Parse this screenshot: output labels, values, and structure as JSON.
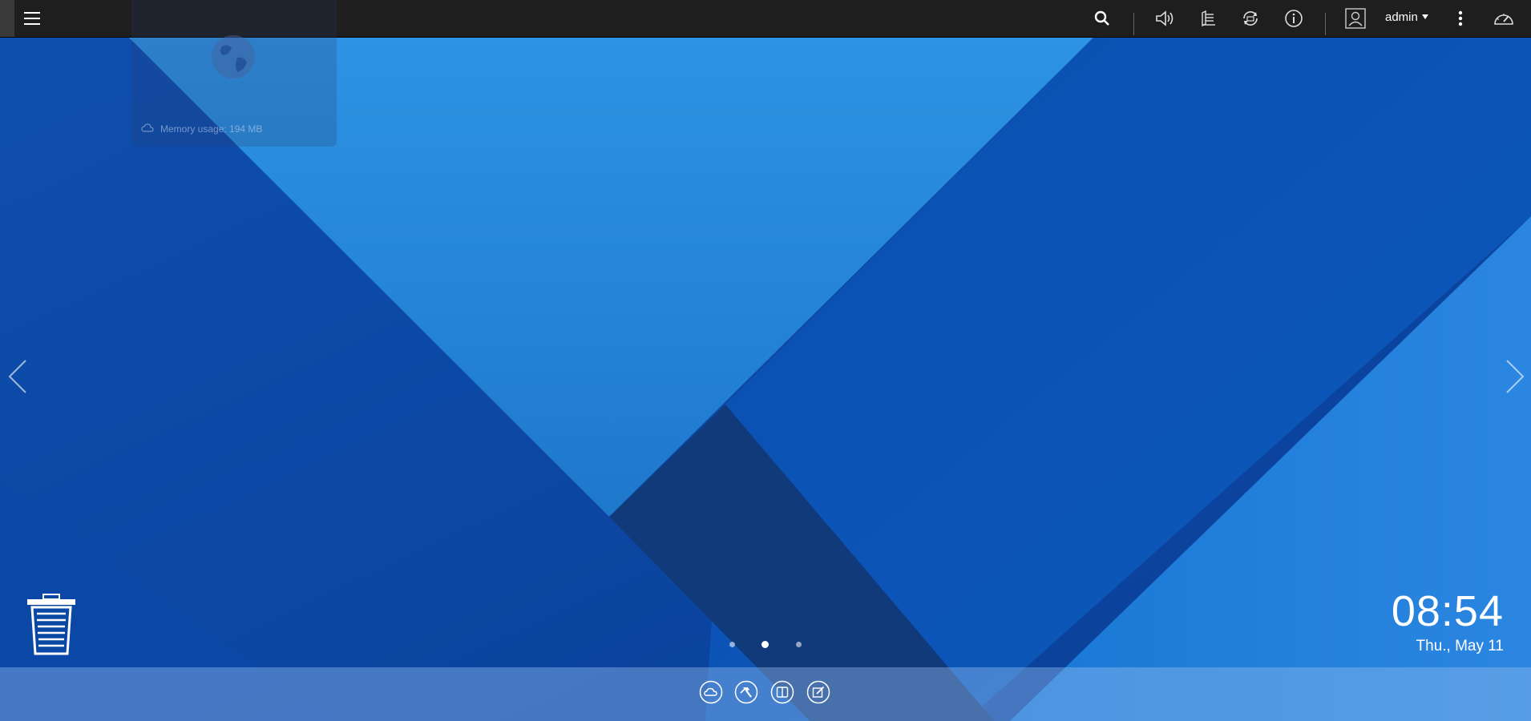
{
  "topbar": {
    "menu_icon": "hamburger-menu-icon",
    "user": "admin",
    "icons": [
      "search-icon",
      "volume-icon",
      "stack-icon",
      "sync-icon",
      "info-icon",
      "user-icon",
      "more-vertical-icon",
      "dashboard-gauge-icon"
    ]
  },
  "widget": {
    "icon": "globe-icon",
    "memory_text": "Memory usage: 194 MB"
  },
  "desktop": {
    "time": "08:54",
    "date": "Thu., May 11",
    "page_count": 3,
    "active_page": 2
  },
  "dock": {
    "icons": [
      "cloud-icon",
      "hammer-icon",
      "book-icon",
      "edit-note-icon"
    ]
  },
  "colors": {
    "topbar": "#1e1e1e",
    "bg_dark": "#0a48a8",
    "bg_light": "#2a8fdf",
    "bg_deep": "#123a78"
  }
}
